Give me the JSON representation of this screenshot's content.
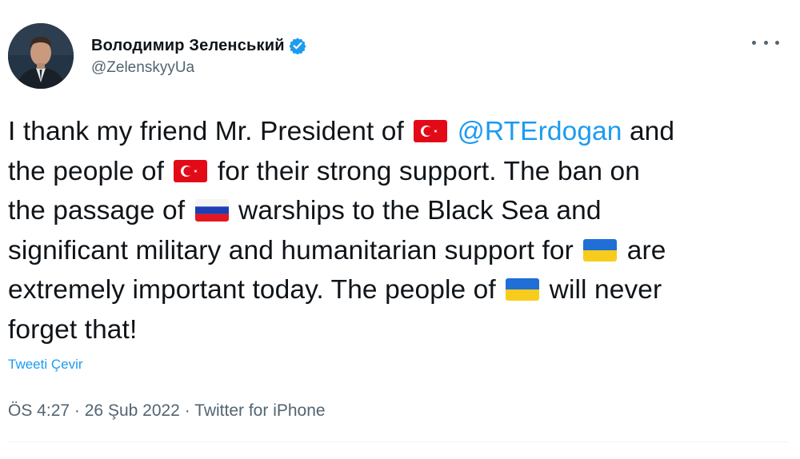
{
  "author": {
    "display_name": "Володимир Зеленський",
    "handle": "@ZelenskyyUa",
    "verified": true,
    "avatar_icon": "profile-photo-avatar"
  },
  "tweet": {
    "line1_a": "I thank my friend Mr. President of",
    "line1_mention": "@RTErdogan",
    "line1_b": "and",
    "line2_a": "the people of",
    "line2_b": "for their strong support. The ban on",
    "line3_a": "the passage of",
    "line3_b": "warships to the Black Sea and",
    "line4_a": "significant military and humanitarian support for",
    "line4_b": "are",
    "line5_a": "extremely important today. The people of",
    "line5_b": "will never",
    "line6": "forget that!",
    "flags": [
      "turkey-flag",
      "turkey-flag",
      "russia-flag",
      "ukraine-flag",
      "ukraine-flag"
    ]
  },
  "translate_label": "Tweeti Çevir",
  "meta": {
    "time": "ÖS 4:27",
    "separator": "·",
    "date": "26 Şub 2022",
    "source": "Twitter for iPhone"
  },
  "colors": {
    "link": "#1d9bf0",
    "secondary_text": "#536471",
    "primary_text": "#0f1419"
  }
}
